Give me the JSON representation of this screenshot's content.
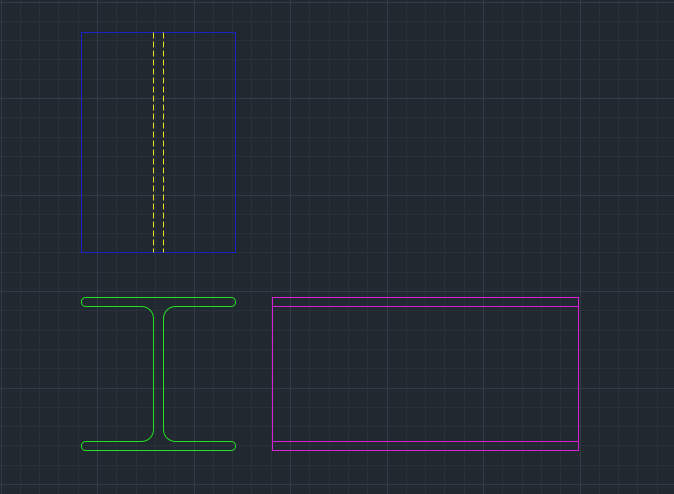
{
  "viewport": {
    "background": "#212830",
    "grid_minor_color": "#293039",
    "grid_major_color": "#333b46"
  },
  "drawing": {
    "top_view": {
      "outline_color": "#1a22c8",
      "hidden_line_color": "#e8e020",
      "hidden_line_style": "dashed"
    },
    "section_view": {
      "profile": "I-beam",
      "outline_color": "#22e022"
    },
    "side_view": {
      "outline_color": "#d820d8"
    }
  }
}
